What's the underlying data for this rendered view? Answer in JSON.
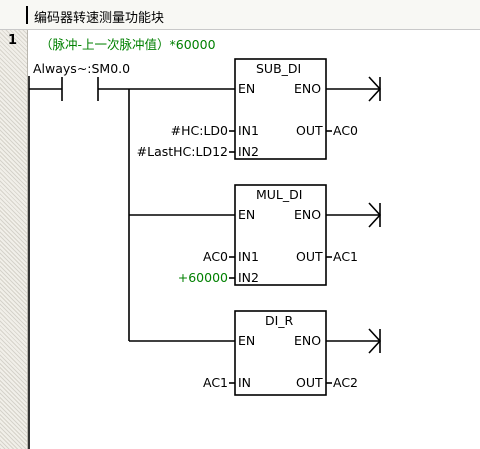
{
  "title": "编码器转速测量功能块",
  "network": {
    "number": "1",
    "comment": "（脉冲-上一次脉冲值）*60000",
    "contact": "Always~:SM0.0",
    "boxes": [
      {
        "name": "SUB_DI",
        "en": "EN",
        "eno": "ENO",
        "in1_label": "IN1",
        "in2_label": "IN2",
        "out_label": "OUT",
        "in1_operand": "#HC:LD0",
        "in2_operand": "#LastHC:LD12",
        "out_operand": "AC0"
      },
      {
        "name": "MUL_DI",
        "en": "EN",
        "eno": "ENO",
        "in1_label": "IN1",
        "in2_label": "IN2",
        "out_label": "OUT",
        "in1_operand": "AC0",
        "in2_operand": "+60000",
        "out_operand": "AC1"
      },
      {
        "name": "DI_R",
        "en": "EN",
        "eno": "ENO",
        "in_label": "IN",
        "out_label": "OUT",
        "in_operand": "AC1",
        "out_operand": "AC2"
      }
    ]
  },
  "colors": {
    "comment": "#008000",
    "constant": "#008000",
    "rail_hatch": "#d6d3cb",
    "title_bg": "#f8f8f4"
  }
}
